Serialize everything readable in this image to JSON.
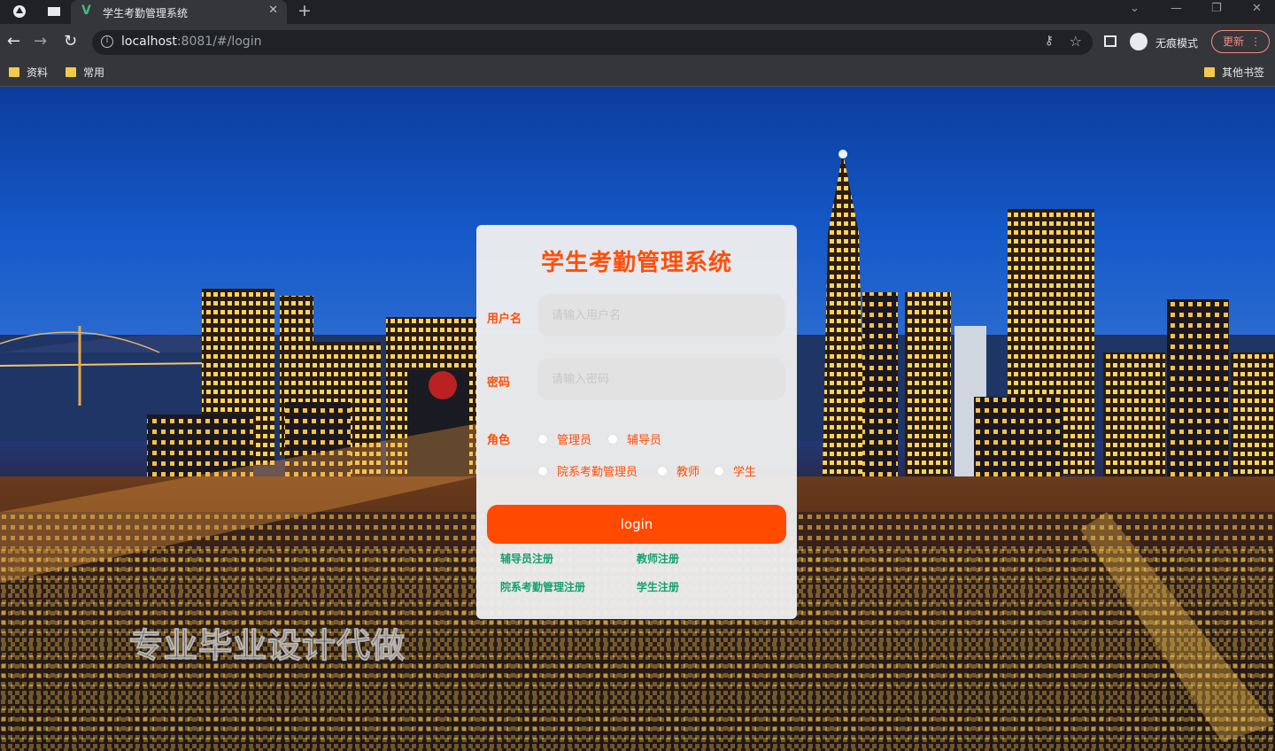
{
  "browser": {
    "tab_title": "学生考勤管理系统",
    "url_host": "localhost",
    "url_rest": ":8081/#/login",
    "incognito_label": "无痕模式",
    "update_label": "更新",
    "bookmarks": [
      "资料",
      "常用"
    ],
    "other_bookmarks": "其他书签"
  },
  "login": {
    "title": "学生考勤管理系统",
    "username_label": "用户名",
    "username_placeholder": "请输入用户名",
    "password_label": "密码",
    "password_placeholder": "请输入密码",
    "role_label": "角色",
    "roles": [
      "管理员",
      "辅导员",
      "院系考勤管理员",
      "教师",
      "学生"
    ],
    "submit_label": "login",
    "register_links": [
      "辅导员注册",
      "教师注册",
      "院系考勤管理注册",
      "学生注册"
    ]
  },
  "watermark": "专业毕业设计代做",
  "colors": {
    "accent": "#ff4f0a",
    "button": "#ff4a00",
    "link": "#16a06e",
    "card": "#eeeeee"
  }
}
